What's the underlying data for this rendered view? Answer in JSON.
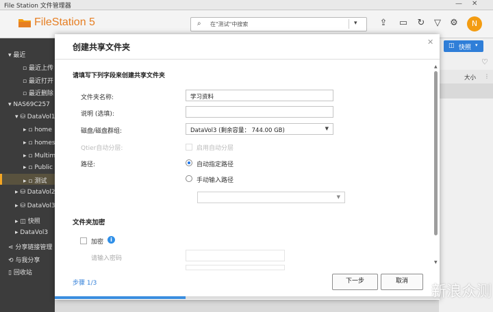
{
  "window": {
    "title": "File Station 文件管理器"
  },
  "app": {
    "name": "FileStation 5"
  },
  "search": {
    "placeholder": "在\"测试\"中搜索"
  },
  "header": {
    "avatar_letter": "N",
    "icons": [
      "upload-icon",
      "monitor-icon",
      "refresh-icon",
      "filter-icon",
      "gear-icon"
    ]
  },
  "sidebar": {
    "items": [
      {
        "label": "最近",
        "depth": 0,
        "marker": "▾"
      },
      {
        "label": "最近上传",
        "depth": 1
      },
      {
        "label": "最近打开",
        "depth": 1
      },
      {
        "label": "最近删除",
        "depth": 1
      },
      {
        "label": "NAS69C257",
        "depth": 0,
        "marker": "▾"
      },
      {
        "label": "DataVol1",
        "depth": 1,
        "marker": "▾"
      },
      {
        "label": "home",
        "depth": 2
      },
      {
        "label": "homes",
        "depth": 2
      },
      {
        "label": "Multimedia",
        "depth": 2
      },
      {
        "label": "Public",
        "depth": 2
      },
      {
        "label": "测试",
        "depth": 2,
        "selected": true
      },
      {
        "label": "DataVol2",
        "depth": 1
      },
      {
        "label": "DataVol3",
        "depth": 1
      },
      {
        "label": "快照",
        "depth": 1
      },
      {
        "label": "DataVol3",
        "depth": 1
      },
      {
        "label": "分享链接管理",
        "depth": 0
      },
      {
        "label": "与我分享",
        "depth": 0
      },
      {
        "label": "回收站",
        "depth": 0
      }
    ]
  },
  "content": {
    "quick_label": "快照",
    "col_size": "大小"
  },
  "dialog": {
    "title": "创建共享文件夹",
    "intro": "请填写下列字段来创建共享文件夹",
    "folder_name_label": "文件夹名称:",
    "folder_name_value": "学习资料",
    "desc_label": "说明 (选填):",
    "desc_value": "",
    "disk_label": "磁盘/磁盘群组:",
    "disk_value": "DataVol3 (剩余容量： 744.00 GB)",
    "qtier_label": "Qtier自动分层:",
    "qtier_check_label": "启用自动分层",
    "path_label": "路径:",
    "path_auto": "自动指定路径",
    "path_manual": "手动输入路径",
    "path_select_value": "",
    "encrypt_title": "文件夹加密",
    "encrypt_check_label": "加密",
    "password_label": "请输入密码",
    "step": "步骤 1/3",
    "next_button": "下一步",
    "cancel_button": "取消",
    "progress": 0.34
  },
  "watermark": "新浪众测",
  "colors": {
    "accent": "#e67e22",
    "selection": "#59523e",
    "primary": "#2f7ed8"
  }
}
